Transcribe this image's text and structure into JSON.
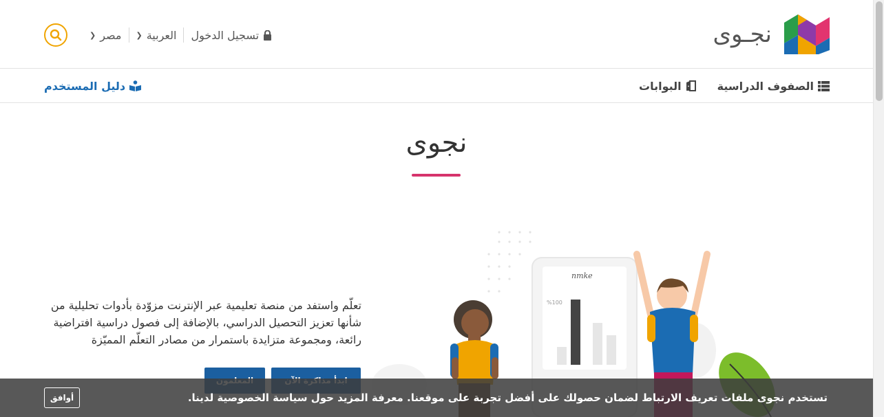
{
  "header": {
    "logo_text": "نجـوى",
    "login_label": "تسجيل الدخول",
    "language_label": "العربية",
    "country_label": "مصر"
  },
  "nav": {
    "classes_label": "الصفوف الدراسية",
    "portals_label": "البوابات",
    "user_guide_label": "دليل المستخدم"
  },
  "hero": {
    "title": "نجوى",
    "description": "تعلّم واستفد من منصة تعليمية عبر الإنترنت مزوّدة بأدوات تحليلية من شأنها تعزيز التحصيل الدراسي، بالإضافة إلى فصول دراسية افتراضية رائعة، ومجموعة متزايدة باستمرار من مصادر التعلّم المميّزة",
    "start_button": "ابدأ مذاكرة الآن",
    "teachers_button": "المعلمون",
    "illustration_chart_label": "%100"
  },
  "cookie": {
    "message": "تستخدم نجوى ملفات تعريف الارتباط لضمان حصولك على أفضل تجربة على موقعنا. معرفة المزيد حول سياسة الخصوصية لدينا.",
    "accept_label": "أوافق"
  },
  "colors": {
    "accent_blue": "#1b5fa0",
    "search_ring": "#f0a400",
    "underline_pink": "#d6336c"
  }
}
